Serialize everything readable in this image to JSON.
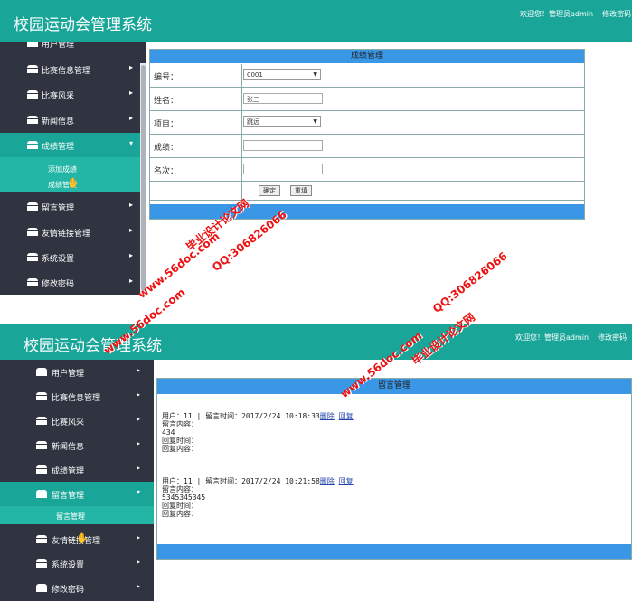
{
  "app": {
    "title": "校园运动会管理系统",
    "welcome": "欢迎您！管理员admin",
    "change_pwd": "修改密码"
  },
  "panel1": {
    "sidebar": {
      "top_partial": "用户管理",
      "items": [
        {
          "label": "比赛信息管理"
        },
        {
          "label": "比赛风采"
        },
        {
          "label": "新闻信息"
        },
        {
          "label": "成绩管理",
          "active": true
        },
        {
          "label": "留言管理"
        },
        {
          "label": "友情链接管理"
        },
        {
          "label": "系统设置"
        },
        {
          "label": "修改密码"
        }
      ],
      "submenu": [
        "添加成绩",
        "成绩管理"
      ]
    },
    "form": {
      "title": "成绩管理",
      "fields": [
        {
          "label": "编号：",
          "type": "select",
          "value": "0001"
        },
        {
          "label": "姓名：",
          "type": "text",
          "value": "张三"
        },
        {
          "label": "项目：",
          "type": "select",
          "value": "跳远"
        },
        {
          "label": "成绩：",
          "type": "text",
          "value": ""
        },
        {
          "label": "名次：",
          "type": "text",
          "value": ""
        }
      ],
      "confirm": "确定",
      "reset": "重填"
    }
  },
  "panel2": {
    "sidebar": {
      "items": [
        {
          "label": "用户管理"
        },
        {
          "label": "比赛信息管理"
        },
        {
          "label": "比赛风采"
        },
        {
          "label": "新闻信息"
        },
        {
          "label": "成绩管理"
        },
        {
          "label": "留言管理",
          "active": true
        },
        {
          "label": "友情链接管理"
        },
        {
          "label": "系统设置"
        },
        {
          "label": "修改密码"
        }
      ],
      "submenu": [
        "留言管理"
      ]
    },
    "messages": {
      "title": "留言管理",
      "delete_label": "删除",
      "reply_label": "回复",
      "items": [
        {
          "head": "用户：11 ||留言时间：2017/2/24 10:18:33",
          "content_label": "留言内容：",
          "content": "434",
          "reply_time_label": "回复时间：",
          "reply_content_label": "回复内容："
        },
        {
          "head": "用户：11 ||留言时间：2017/2/24 10:21:58",
          "content_label": "留言内容：",
          "content": "5345345345",
          "reply_time_label": "回复时间：",
          "reply_content_label": "回复内容："
        }
      ]
    }
  },
  "watermark": {
    "site": "www.56doc.com",
    "qq": "QQ:306826066",
    "name": "毕业设计论文网",
    "color": "#ee1111"
  },
  "colors": {
    "header": "#19a699",
    "sidebar": "#2f3440",
    "active": "#19a699",
    "submenu": "#23b5a6",
    "bar": "#3a97e6"
  }
}
